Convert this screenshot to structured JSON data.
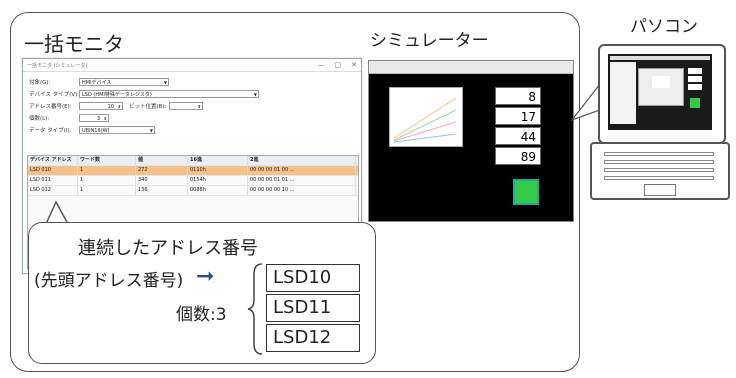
{
  "titles": {
    "monitor": "一括モニタ",
    "simulator": "シミュレーター",
    "pc": "パソコン"
  },
  "monitor_window": {
    "title": "一括モニタ (シミュレータ)",
    "controls": [
      "—",
      "□",
      "✕"
    ],
    "fields": [
      {
        "label": "対象(G):",
        "value": "HMIデバイス"
      },
      {
        "label": "デバイス タイプ(V):",
        "value": "LSD (HMI特殊データレジスタ)"
      },
      {
        "label": "アドレス番号(E):",
        "value": "10"
      },
      {
        "label": "ビット位置(B):",
        "value": ""
      },
      {
        "label": "個数(L):",
        "value": "3"
      },
      {
        "label": "データ タイプ(I):",
        "value": "UBIN16(W)"
      }
    ],
    "grid": {
      "headers": [
        "デバイス アドレス",
        "ワード数",
        "値",
        "16進",
        "2進"
      ],
      "rows": [
        [
          "LSD 010",
          "1",
          "272",
          "0110h",
          "00 00 00 01 00 ..."
        ],
        [
          "LSD 011",
          "1",
          "340",
          "0154h",
          "00 00 00 01 01 ..."
        ],
        [
          "LSD 012",
          "1",
          "136",
          "0088h",
          "00 00 00 00 10 ..."
        ]
      ]
    }
  },
  "callout": {
    "line1": "連続したアドレス番号",
    "line2": "(先頭アドレス番号)",
    "arrow": "➞",
    "count_label": "個数:3",
    "addresses": [
      "LSD10",
      "LSD11",
      "LSD12"
    ]
  },
  "simulator": {
    "values": [
      "8",
      "17",
      "44",
      "89"
    ],
    "led_color": "#35c94a"
  }
}
